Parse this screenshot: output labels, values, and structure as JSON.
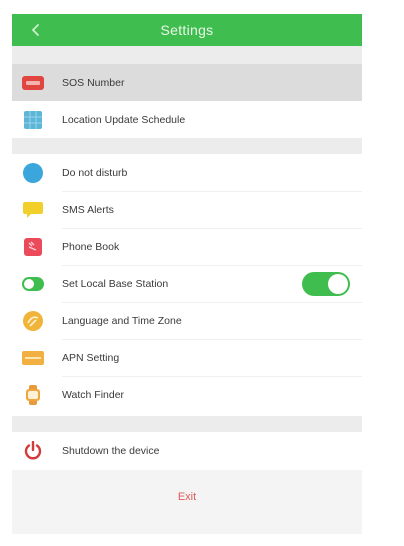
{
  "header": {
    "title": "Settings",
    "back_icon": "arrow-left-icon"
  },
  "colors": {
    "header_green": "#3fbe4f",
    "exit_red": "#e05a5a",
    "shutdown_red": "#d33a3a"
  },
  "group1": [
    {
      "label": "SOS Number",
      "icon": "sos-icon",
      "selected": true
    },
    {
      "label": "Location Update Schedule",
      "icon": "schedule-icon"
    }
  ],
  "group2": [
    {
      "label": "Do not disturb",
      "icon": "moon-icon"
    },
    {
      "label": "SMS Alerts",
      "icon": "message-icon"
    },
    {
      "label": "Phone Book",
      "icon": "phonebook-icon"
    },
    {
      "label": "Set Local Base Station",
      "icon": "toggle-icon",
      "toggle_on": true
    },
    {
      "label": "Language and Time Zone",
      "icon": "globe-icon"
    },
    {
      "label": "APN Setting",
      "icon": "apn-icon"
    },
    {
      "label": "Watch Finder",
      "icon": "watch-icon"
    }
  ],
  "group3": [
    {
      "label": "Shutdown the device",
      "icon": "power-icon"
    }
  ],
  "exit_label": "Exit"
}
